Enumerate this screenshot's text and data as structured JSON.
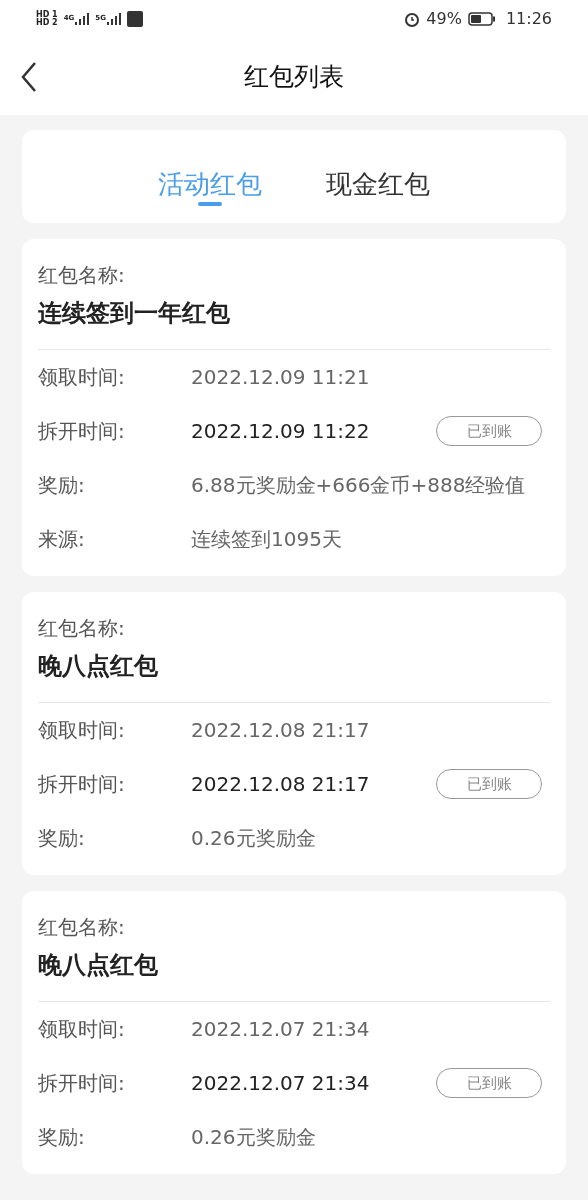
{
  "status_bar": {
    "sim_labels": [
      "HD 1",
      "HD 2"
    ],
    "networks": [
      "4G",
      "5G"
    ],
    "battery": "49%",
    "time": "11:26"
  },
  "header": {
    "title": "红包列表"
  },
  "tabs": [
    {
      "label": "活动红包",
      "selected": true
    },
    {
      "label": "现金红包",
      "selected": false
    }
  ],
  "cards": [
    {
      "name_label": "红包名称:",
      "name": "连续签到一年红包",
      "rows": [
        {
          "label": "领取时间:",
          "value": "2022.12.09 11:21",
          "emphasis": false
        },
        {
          "label": "拆开时间:",
          "value": "2022.12.09 11:22",
          "emphasis": true,
          "badge": "已到账"
        },
        {
          "label": "奖励:",
          "value": "6.88元奖励金+666金币+888经验值",
          "emphasis": false
        },
        {
          "label": "来源:",
          "value": "连续签到1095天",
          "emphasis": false
        }
      ]
    },
    {
      "name_label": "红包名称:",
      "name": "晚八点红包",
      "rows": [
        {
          "label": "领取时间:",
          "value": "2022.12.08 21:17",
          "emphasis": false
        },
        {
          "label": "拆开时间:",
          "value": "2022.12.08 21:17",
          "emphasis": true,
          "badge": "已到账"
        },
        {
          "label": "奖励:",
          "value": "0.26元奖励金",
          "emphasis": false
        }
      ]
    },
    {
      "name_label": "红包名称:",
      "name": "晚八点红包",
      "rows": [
        {
          "label": "领取时间:",
          "value": "2022.12.07 21:34",
          "emphasis": false
        },
        {
          "label": "拆开时间:",
          "value": "2022.12.07 21:34",
          "emphasis": true,
          "badge": "已到账"
        },
        {
          "label": "奖励:",
          "value": "0.26元奖励金",
          "emphasis": false
        }
      ]
    }
  ]
}
